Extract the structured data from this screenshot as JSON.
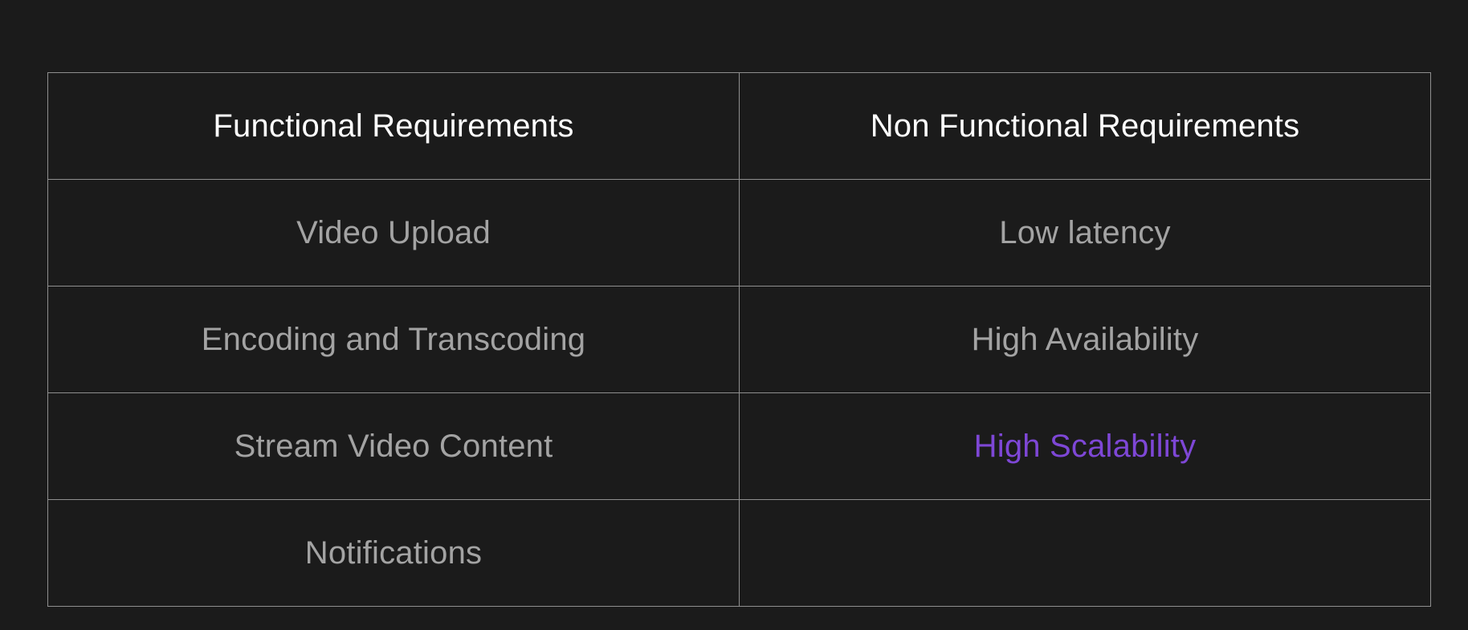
{
  "table": {
    "headers": [
      "Functional Requirements",
      "Non Functional Requirements"
    ],
    "rows": [
      [
        "Video Upload",
        "Low latency"
      ],
      [
        "Encoding and Transcoding",
        "High Availability"
      ],
      [
        "Stream Video Content",
        "High Scalability"
      ],
      [
        "Notifications",
        ""
      ]
    ],
    "highlighted_cell": "High Scalability"
  },
  "colors": {
    "background": "#1b1b1b",
    "border": "#8f8f8f",
    "header_text": "#ffffff",
    "body_text": "#a3a3a3",
    "highlight_text": "#7e47d6"
  }
}
